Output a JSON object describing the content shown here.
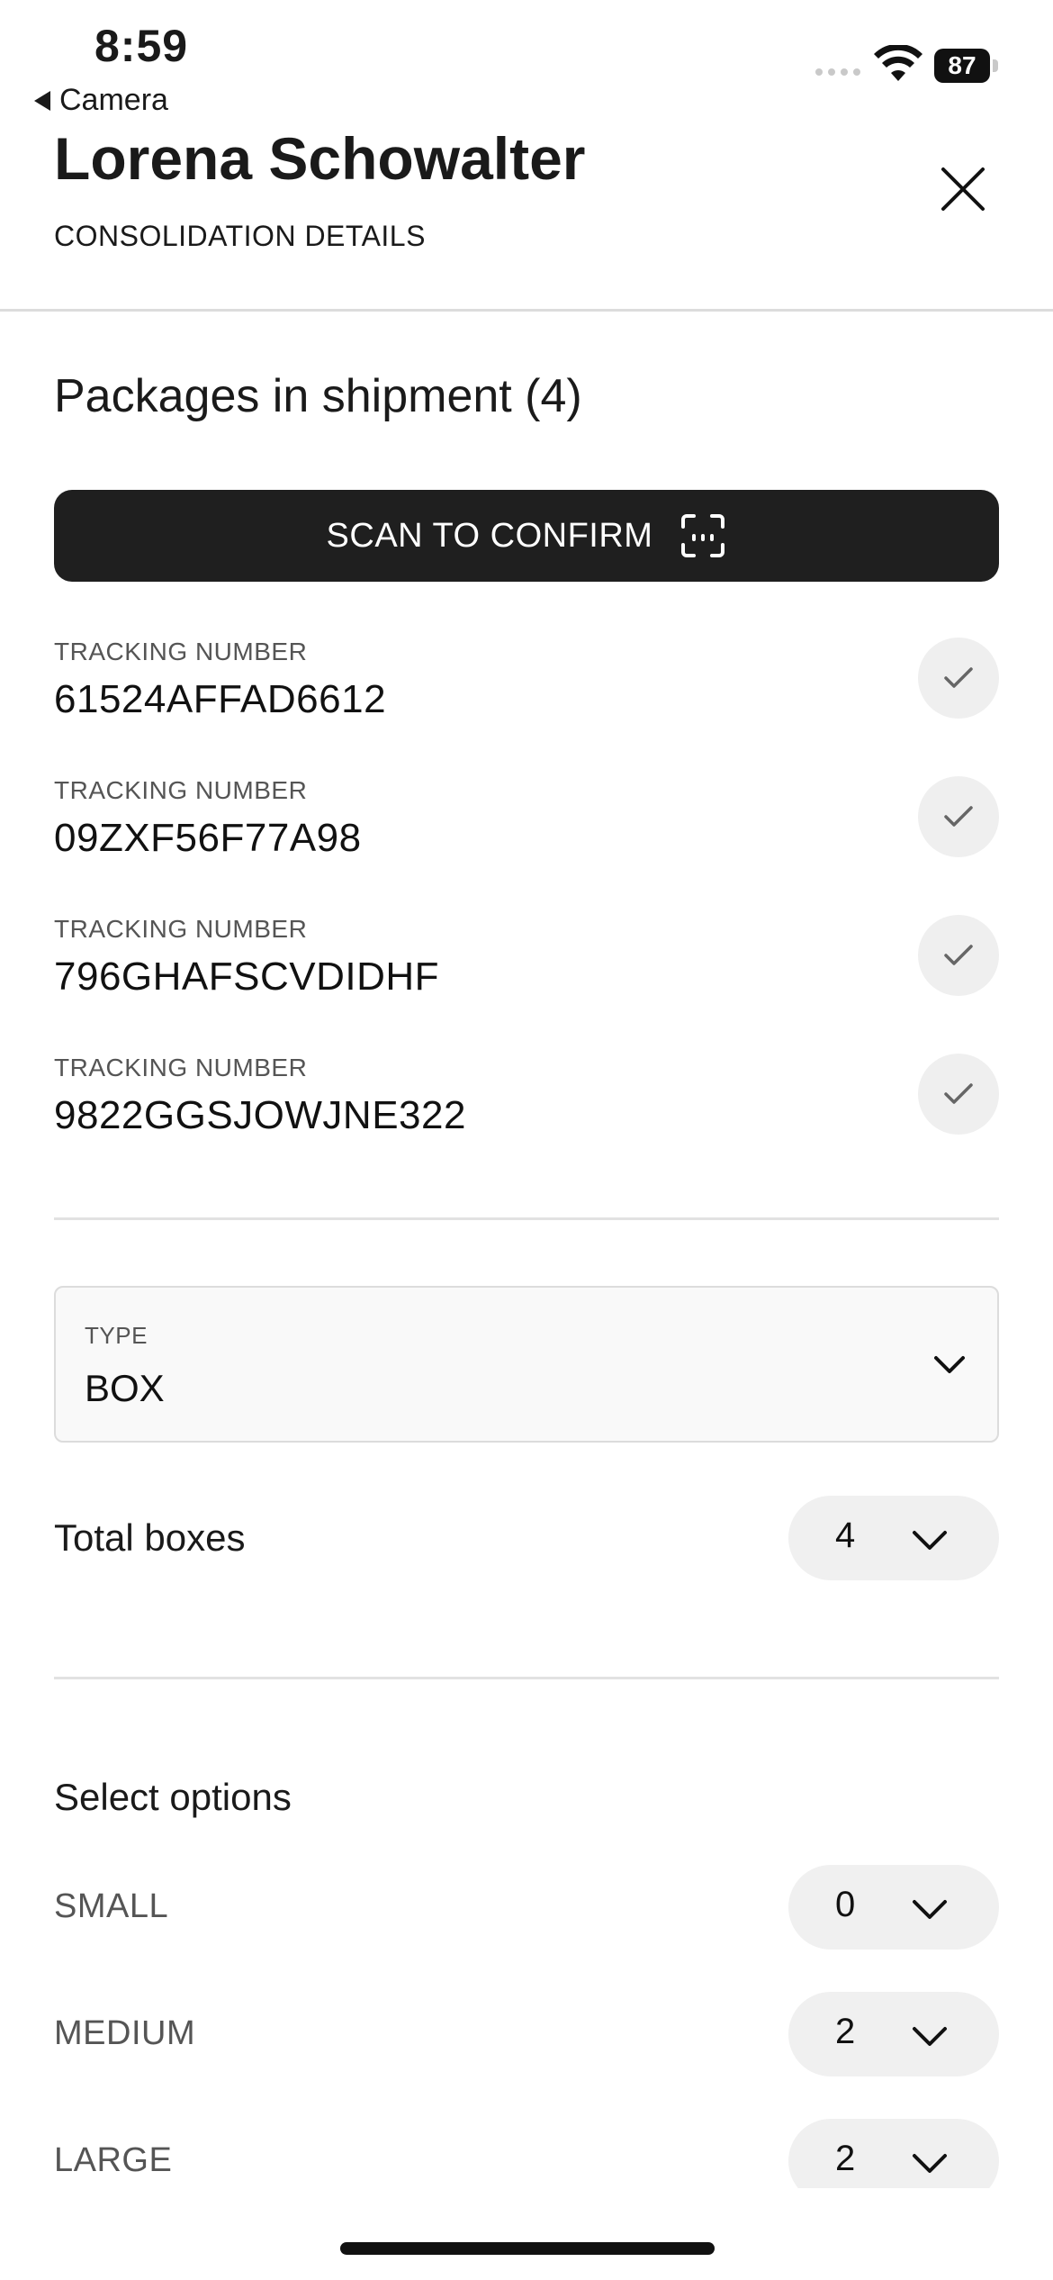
{
  "status_bar": {
    "time": "8:59",
    "back_label": "Camera",
    "battery": "87"
  },
  "header": {
    "name": "Lorena Schowalter",
    "subtitle": "CONSOLIDATION DETAILS"
  },
  "packages": {
    "title": "Packages in shipment (4)",
    "scan_button_label": "SCAN TO CONFIRM",
    "items": [
      {
        "label": "TRACKING NUMBER",
        "number": "61524AFFAD6612",
        "confirmed": true
      },
      {
        "label": "TRACKING NUMBER",
        "number": "09ZXF56F77A98",
        "confirmed": true
      },
      {
        "label": "TRACKING NUMBER",
        "number": "796GHAFSCVDIDHF",
        "confirmed": true
      },
      {
        "label": "TRACKING NUMBER",
        "number": "9822GGSJOWJNE322",
        "confirmed": true
      }
    ]
  },
  "type_select": {
    "label": "TYPE",
    "value": "BOX"
  },
  "total_boxes": {
    "label": "Total boxes",
    "value": "4"
  },
  "options": {
    "title": "Select options",
    "items": [
      {
        "label": "SMALL",
        "value": "0"
      },
      {
        "label": "MEDIUM",
        "value": "2"
      },
      {
        "label": "LARGE",
        "value": "2"
      }
    ]
  },
  "colors": {
    "scan_button_bg": "#1f1f1f",
    "pill_bg": "#f0f0f0",
    "check_bg": "#efefef"
  }
}
